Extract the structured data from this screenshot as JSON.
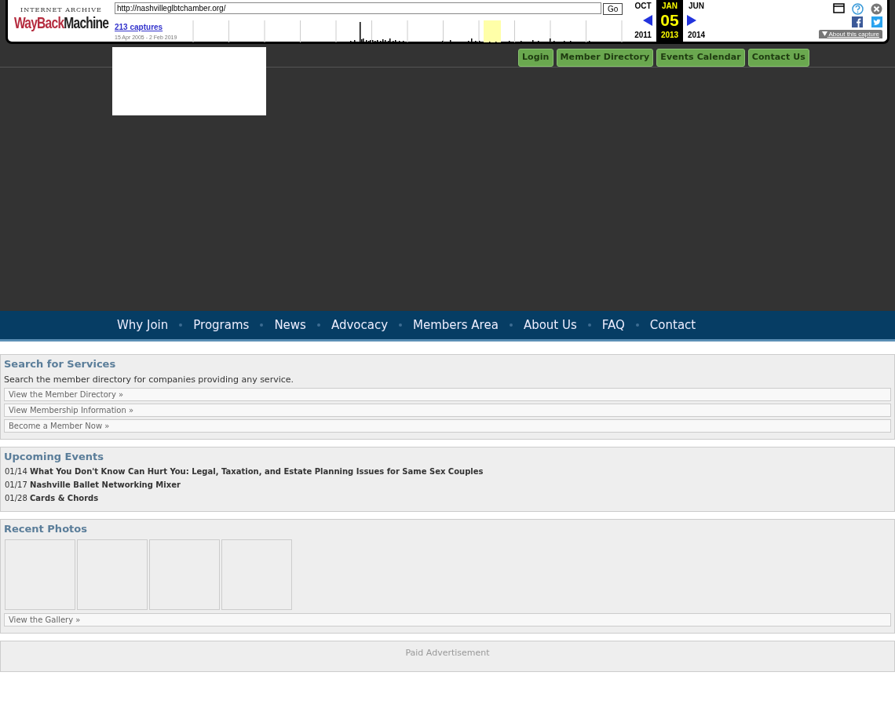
{
  "wayback": {
    "logo_top": "INTERNET ARCHIVE",
    "logo_main": "WayBack",
    "logo_main_end": "Machine",
    "url": "http://nashvilleglbtchamber.org/",
    "go": "Go",
    "captures": "213 captures",
    "range": "15 Apr 2005 - 2 Feb 2019",
    "months": [
      {
        "month": "OCT",
        "year": "2011",
        "selected": false
      },
      {
        "month": "JAN",
        "day": "05",
        "year": "2013",
        "selected": true
      },
      {
        "month": "JUN",
        "year": "2014",
        "selected": false
      }
    ],
    "about": "About this capture"
  },
  "top_links": [
    "Login",
    "Member Directory",
    "Events Calendar",
    "Contact Us"
  ],
  "nav": [
    "Why Join",
    "Programs",
    "News",
    "Advocacy",
    "Members Area",
    "About Us",
    "FAQ",
    "Contact"
  ],
  "panels": [
    {
      "kind": "links",
      "title": "Search for Services",
      "text": "Search the member directory for companies providing any service.",
      "links": [
        "View the Member Directory »",
        "View Membership Information »",
        "Become a Member Now »"
      ]
    },
    {
      "kind": "events",
      "title": "Upcoming Events",
      "events": [
        {
          "date": "01/14",
          "title": "What You Don't Know Can Hurt You: Legal, Taxation, and Estate Planning Issues for Same Sex Couples"
        },
        {
          "date": "01/17",
          "title": "Nashville Ballet Networking Mixer"
        },
        {
          "date": "01/28",
          "title": "Cards & Chords"
        }
      ]
    },
    {
      "kind": "photos",
      "title": "Recent Photos",
      "photos": [
        {
          "loaded": false
        },
        {
          "loaded": false
        },
        {
          "loaded": false
        },
        {
          "loaded": false
        }
      ],
      "links": [
        "View the Gallery »"
      ]
    },
    {
      "kind": "ad",
      "text": "Paid Advertisement"
    }
  ]
}
